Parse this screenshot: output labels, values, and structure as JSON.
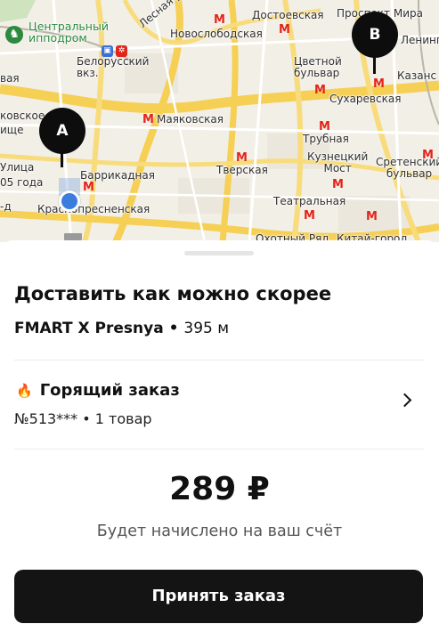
{
  "map": {
    "pin_a_label": "A",
    "pin_b_label": "B",
    "metro_symbol": "M",
    "labels": {
      "hippodrome": "Центральный\nипподром",
      "belorussky": "Белорусский\nвкз.",
      "lesnaya": "Лесная ул.",
      "novoslobodskaya": "Новослободская",
      "dostoevskaya": "Достоевская",
      "prospekt_mira": "Проспект Мира",
      "leningradsky": "Ленингр",
      "tsvetnoy": "Цветной\nбульвар",
      "kazansky": "Казанс",
      "sukharevskaya": "Сухаревская",
      "mayakovskaya": "Маяковская",
      "trubnaya": "Трубная",
      "kuznetsky": "Кузнецкий\nМост",
      "sretensky": "Сретенский\nбульвар",
      "tverskaya": "Тверская",
      "barrikadnaya": "Баррикадная",
      "krasnopresnenskaya": "Краснопресненская",
      "teatralnaya": "Театральная",
      "okhotny": "Охотный Ряд",
      "kitay_gorod": "Китай-город",
      "edge_vaya": "вая",
      "edge_kovskoe": "ковское",
      "edge_ische": "ище",
      "edge_ulitsa": "Улица",
      "edge_05goda": "05 года",
      "edge_d": "-д"
    }
  },
  "sheet": {
    "title": "Доставить как можно скорее",
    "store_name": "FMART X Presnya",
    "store_sep": " • ",
    "store_distance": "395 м",
    "hot_title": "Горящий заказ",
    "hot_sub": "№513*** • 1 товар",
    "price": "289 ₽",
    "price_note": "Будет начислено на ваш счёт",
    "accept_label": "Принять заказ"
  },
  "colors": {
    "metro": "#e3241b",
    "button_bg": "#141414",
    "location_dot": "#3b7ddd",
    "fire": "#e8590c"
  },
  "icons": [
    "horse-icon",
    "train-icon",
    "metro-icon",
    "fire-icon",
    "chevron-right-icon",
    "location-dot-icon"
  ]
}
